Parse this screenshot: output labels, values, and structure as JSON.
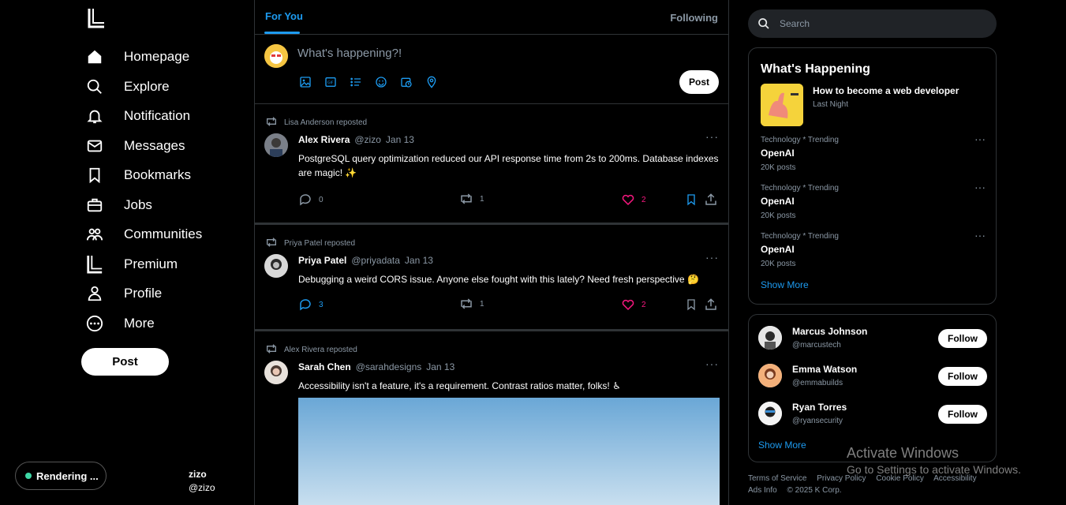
{
  "sidebar": {
    "items": [
      {
        "label": "Homepage",
        "icon": "home-icon"
      },
      {
        "label": "Explore",
        "icon": "search-icon"
      },
      {
        "label": "Notification",
        "icon": "bell-icon"
      },
      {
        "label": "Messages",
        "icon": "mail-icon"
      },
      {
        "label": "Bookmarks",
        "icon": "bookmark-icon"
      },
      {
        "label": "Jobs",
        "icon": "briefcase-icon"
      },
      {
        "label": "Communities",
        "icon": "people-icon"
      },
      {
        "label": "Premium",
        "icon": "logo-icon"
      },
      {
        "label": "Profile",
        "icon": "person-icon"
      },
      {
        "label": "More",
        "icon": "more-circle-icon"
      }
    ],
    "post_button": "Post",
    "rendering_label": "Rendering ...",
    "account": {
      "name": "zizo",
      "handle": "@zizo"
    }
  },
  "feed": {
    "tabs": {
      "for_you": "For You",
      "following": "Following"
    },
    "composer": {
      "placeholder": "What's happening?!",
      "post_button": "Post"
    },
    "posts": [
      {
        "repost_by": "Lisa Anderson reposted",
        "name": "Alex Rivera",
        "handle": "@zizo",
        "date": "Jan 13",
        "text": "PostgreSQL query optimization reduced our API response time from 2s to 200ms. Database indexes are magic! ✨",
        "replies": "0",
        "reposts": "1",
        "likes": "2"
      },
      {
        "repost_by": "Priya Patel reposted",
        "name": "Priya Patel",
        "handle": "@priyadata",
        "date": "Jan 13",
        "text": "Debugging a weird CORS issue. Anyone else fought with this lately? Need fresh perspective 🤔",
        "replies": "3",
        "reposts": "1",
        "likes": "2"
      },
      {
        "repost_by": "Alex Rivera reposted",
        "name": "Sarah Chen",
        "handle": "@sarahdesigns",
        "date": "Jan 13",
        "text": "Accessibility isn't a feature, it's a requirement. Contrast ratios matter, folks! ♿"
      }
    ]
  },
  "right": {
    "search_placeholder": "Search",
    "whats_happening": {
      "title": "What's Happening",
      "featured": {
        "title": "How to become a web developer",
        "sub": "Last Night"
      },
      "trends": [
        {
          "category": "Technology * Trending",
          "name": "OpenAI",
          "count": "20K posts"
        },
        {
          "category": "Technology * Trending",
          "name": "OpenAI",
          "count": "20K posts"
        },
        {
          "category": "Technology * Trending",
          "name": "OpenAI",
          "count": "20K posts"
        }
      ],
      "show_more": "Show More"
    },
    "who_to_follow": {
      "people": [
        {
          "name": "Marcus Johnson",
          "handle": "@marcustech",
          "button": "Follow"
        },
        {
          "name": "Emma Watson",
          "handle": "@emmabuilds",
          "button": "Follow"
        },
        {
          "name": "Ryan Torres",
          "handle": "@ryansecurity",
          "button": "Follow"
        }
      ],
      "show_more": "Show More"
    },
    "footer": {
      "terms": "Terms of Service",
      "privacy": "Privacy Policy",
      "cookie": "Cookie Policy",
      "accessibility": "Accessibility",
      "ads": "Ads Info",
      "copyright": "© 2025 K Corp."
    }
  },
  "overlay": {
    "activate_title": "Activate Windows",
    "activate_sub": "Go to Settings to activate Windows."
  },
  "colors": {
    "accent": "#1d9bf0",
    "like": "#f91880",
    "background": "#000000",
    "border": "#2f3336"
  }
}
